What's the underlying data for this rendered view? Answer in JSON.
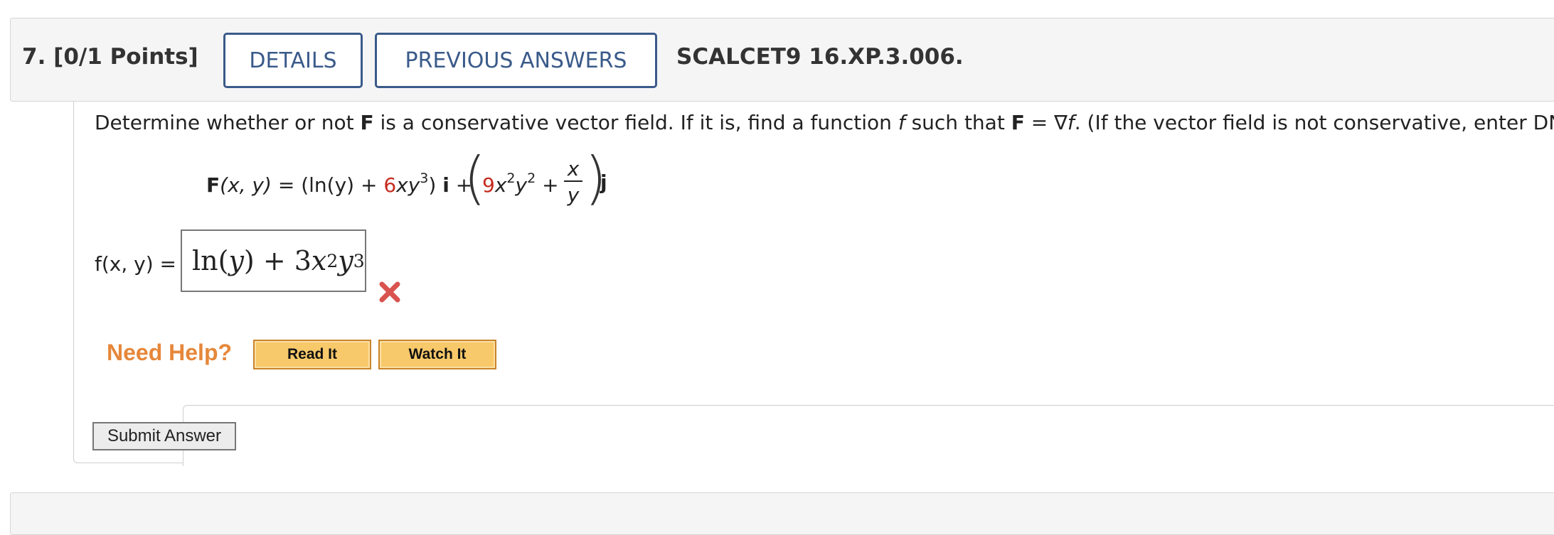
{
  "question": {
    "number_label": "7.",
    "points_label": "[0/1 Points]",
    "details_button": "DETAILS",
    "previous_answers_button": "PREVIOUS ANSWERS",
    "problem_code": "SCALCET9 16.XP.3.006."
  },
  "prompt": {
    "part1": "Determine whether or not ",
    "F1": "F",
    "part2": " is a conservative vector field. If it is, find a function ",
    "f": "f",
    "part3": " such that ",
    "F2": "F",
    "part4": " = ∇",
    "f2": "f",
    "part5": ". (If the vector field is not conservative, enter DNE.)"
  },
  "equation": {
    "F": "F",
    "args": "(x, y)",
    "eq_open": " = (ln(y) + ",
    "coef1": "6",
    "term1": "xy",
    "exp1": "3",
    "close1": ")",
    "i": "i",
    "plus": " +",
    "coef2": "9",
    "term2a": "x",
    "exp2a": "2",
    "term2b": "y",
    "exp2b": "2",
    "plus2": "+",
    "frac_num": "x",
    "frac_den": "y",
    "j": "j"
  },
  "answer": {
    "label": "f(x, y) =",
    "value_a": "ln(",
    "value_y": "y",
    "value_b": ") + 3",
    "value_x": "x",
    "exp_x": "2",
    "value_y2": "y",
    "exp_y": "3",
    "status": "incorrect"
  },
  "help": {
    "need_help_label": "Need Help?",
    "read_it": "Read It",
    "watch_it": "Watch It"
  },
  "submit_label": "Submit Answer",
  "colors": {
    "accent_blue": "#3a5a8a",
    "coefficient_red": "#c62a1f",
    "help_orange": "#e6873a",
    "wrong_mark": "#d9534f"
  }
}
